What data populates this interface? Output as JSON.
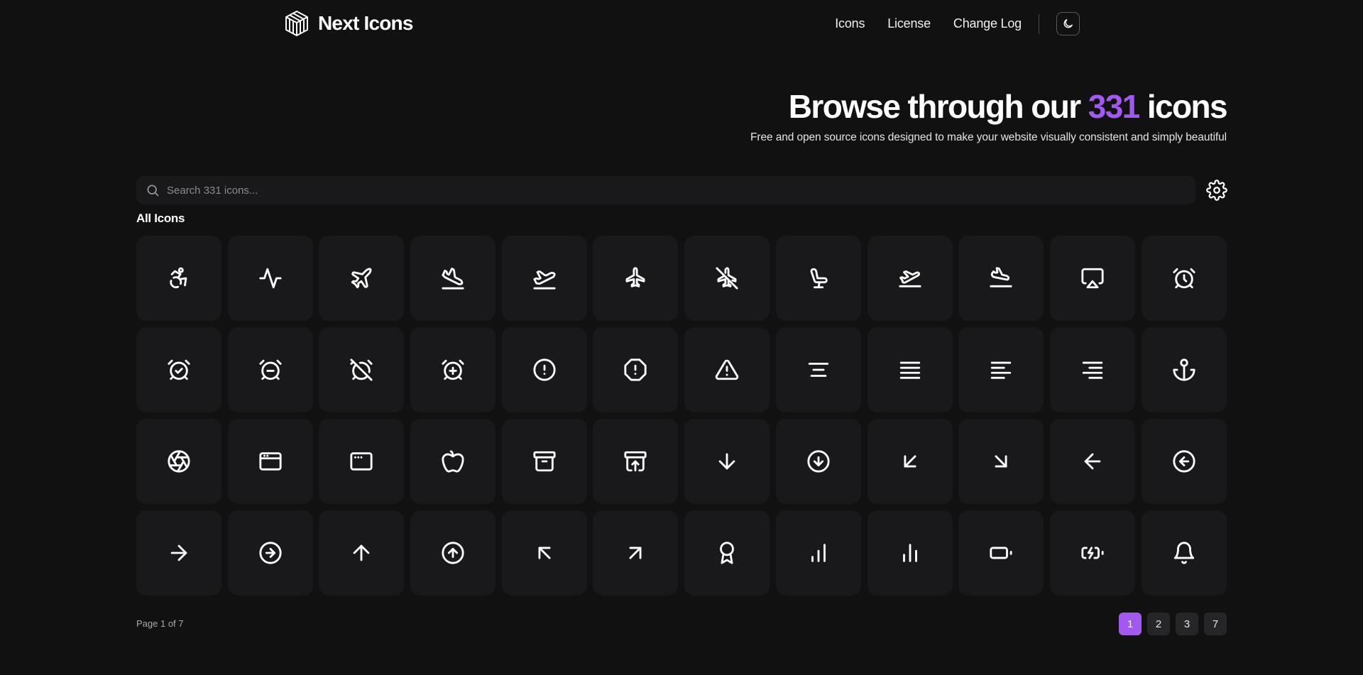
{
  "brand": {
    "name": "Next Icons",
    "logo_icon": "cube-logo-icon"
  },
  "nav": {
    "links": [
      "Icons",
      "License",
      "Change Log"
    ],
    "theme_toggle_icon": "moon-icon"
  },
  "hero": {
    "title_before": "Browse through our ",
    "title_count": "331",
    "title_after": " icons",
    "subtitle": "Free and open source icons designed to make your website visually consistent and simply beautiful"
  },
  "search": {
    "placeholder": "Search 331 icons...",
    "value": "",
    "icon": "search-icon"
  },
  "settings": {
    "icon": "gear-icon"
  },
  "section": {
    "title": "All Icons"
  },
  "icons": [
    "accessibility",
    "activity",
    "airplane",
    "airplane-landing",
    "airplane-takeoff",
    "airplane-up",
    "airplane-off",
    "airline-seat",
    "flight-takeoff",
    "flight-landing",
    "airplay",
    "alarm-clock",
    "alarm-check",
    "alarm-minus",
    "alarm-off",
    "alarm-plus",
    "alert-circle",
    "alert-octagon",
    "alert-triangle",
    "align-center",
    "align-justify",
    "align-left",
    "align-right",
    "anchor",
    "aperture",
    "app-window",
    "app-window-dots",
    "apple",
    "archive",
    "archive-restore",
    "arrow-down",
    "arrow-down-circle",
    "arrow-down-left",
    "arrow-down-right",
    "arrow-left",
    "arrow-left-circle",
    "arrow-right",
    "arrow-right-circle",
    "arrow-up",
    "arrow-up-circle",
    "arrow-up-left",
    "arrow-up-right",
    "award",
    "bar-chart",
    "bar-chart-alt",
    "battery",
    "battery-charging",
    "bell"
  ],
  "pagination": {
    "info": "Page 1 of 7",
    "pages": [
      "1",
      "2",
      "3",
      "7"
    ],
    "current": "1"
  },
  "colors": {
    "background": "#111111",
    "tile": "#19191b",
    "accent": "#a259f0",
    "icon_stroke": "#ffffff"
  }
}
